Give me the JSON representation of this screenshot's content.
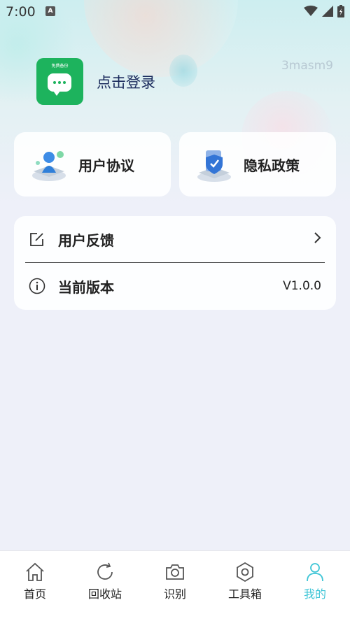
{
  "status_bar": {
    "time": "7:00",
    "notification_badge": "A",
    "icons": [
      "wifi-icon",
      "signal-icon",
      "battery-icon"
    ]
  },
  "profile": {
    "logo_text": "免费备份",
    "login_label": "点击登录",
    "watermark": "3masm9",
    "logo_color": "#1db35d"
  },
  "quick_cards": [
    {
      "label": "用户协议",
      "icon": "user-agreement-icon"
    },
    {
      "label": "隐私政策",
      "icon": "privacy-shield-icon"
    }
  ],
  "settings_list": [
    {
      "label": "用户反馈",
      "icon": "edit-icon",
      "trailing_icon": "chevron-right-icon"
    },
    {
      "label": "当前版本",
      "icon": "info-icon",
      "value": "V1.0.0"
    }
  ],
  "tab_bar": {
    "items": [
      {
        "label": "首页",
        "icon": "home-icon"
      },
      {
        "label": "回收站",
        "icon": "refresh-icon"
      },
      {
        "label": "识别",
        "icon": "camera-icon"
      },
      {
        "label": "工具箱",
        "icon": "gear-icon"
      },
      {
        "label": "我的",
        "icon": "person-icon",
        "active": true
      }
    ],
    "active_color": "#3ec5d6"
  }
}
